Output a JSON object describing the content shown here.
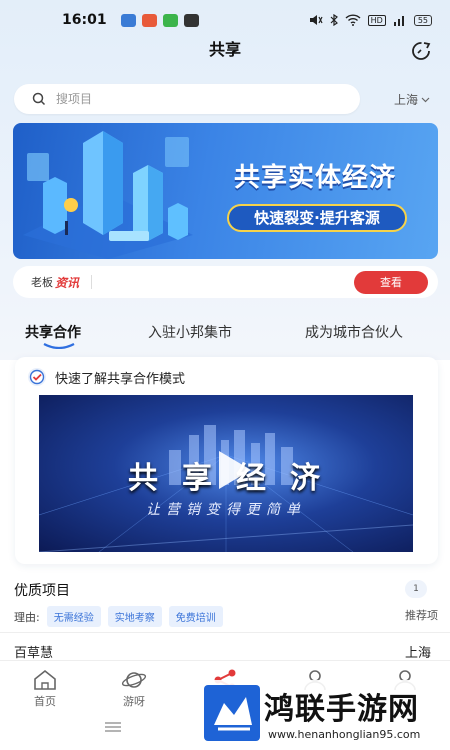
{
  "status": {
    "time": "16:01",
    "app_icons": [
      {
        "name": "app-blue-icon",
        "color": "#3a7bd5"
      },
      {
        "name": "app-red-icon",
        "color": "#e85a3a"
      },
      {
        "name": "app-orange-icon",
        "color": "#f08a2a"
      },
      {
        "name": "app-green-icon",
        "color": "#3cb44b"
      }
    ],
    "network": "HD",
    "battery": "55"
  },
  "header": {
    "title": "共享"
  },
  "search": {
    "placeholder": "搜项目",
    "city": "上海"
  },
  "banner": {
    "headline": "共享实体经济",
    "subline": "快速裂变·提升客源"
  },
  "news": {
    "label_a": "老板",
    "label_b": "资讯",
    "button": "查看"
  },
  "tabs": [
    {
      "label": "共享合作",
      "active": true
    },
    {
      "label": "入驻小邦集市",
      "active": false
    },
    {
      "label": "成为城市合伙人",
      "active": false
    }
  ],
  "intro_card": {
    "title": "快速了解共享合作模式",
    "video_title": "共享经济",
    "video_subtitle": "让营销变得更简单"
  },
  "projects": {
    "heading": "优质项目",
    "reason_label": "理由:",
    "tags": [
      "无需经验",
      "实地考察",
      "免费培训"
    ],
    "side_count": "1",
    "side_label": "推荐项",
    "first_item": {
      "name": "百草慧",
      "city": "上海"
    }
  },
  "bottom_nav": [
    {
      "label": "首页",
      "icon": "home-icon"
    },
    {
      "label": "游呀",
      "icon": "planet-icon"
    },
    {
      "label": "",
      "icon": "share-icon"
    },
    {
      "label": "",
      "icon": "contacts-icon"
    },
    {
      "label": "",
      "icon": "profile-icon"
    }
  ],
  "watermark": {
    "title": "鸿联手游网",
    "url": "www.henanhonglian95.com"
  },
  "colors": {
    "accent": "#e23a3a",
    "brand_blue": "#2f6fe0",
    "tag_blue": "#3a73d8"
  }
}
